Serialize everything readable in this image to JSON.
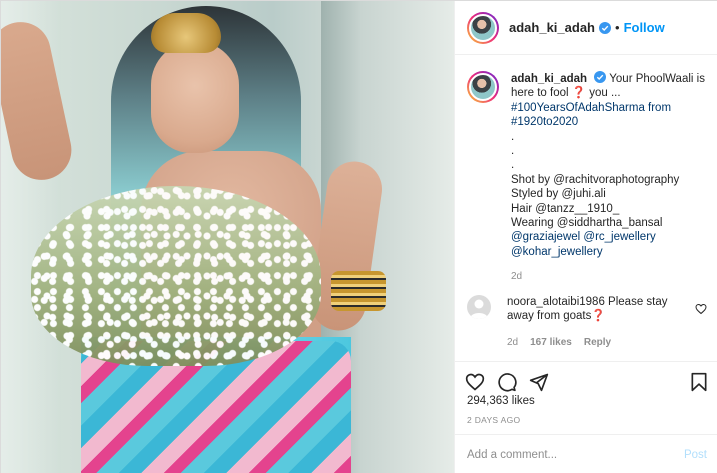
{
  "post": {
    "author": {
      "username": "adah_ki_adah",
      "verified": true
    },
    "header": {
      "dot": "•",
      "follow_label": "Follow"
    },
    "caption": {
      "username": "adah_ki_adah",
      "lines": [
        "Your PhoolWaali is",
        "here to fool ❓ you ...",
        "#100YearsOfAdahSharma from",
        "#1920to2020",
        ".",
        ".",
        ".",
        "Shot by @rachitvoraphotography",
        "Styled by @juhi.ali",
        "Hair @tanzz__1910_",
        "Wearing @siddhartha_bansal",
        "@graziajewel @rc_jewellery",
        "@kohar_jewellery"
      ],
      "time": "2d"
    },
    "comment": {
      "username": "noora_alotaibi1986",
      "text": "Please stay away from goats❓",
      "time": "2d",
      "likes": "167 likes",
      "reply_label": "Reply"
    },
    "likes_text": "294,363 likes",
    "timestamp": "2 DAYS AGO",
    "add_comment_placeholder": "Add a comment...",
    "post_label": "Post"
  },
  "icons": {
    "like": "heart-icon",
    "comment": "comment-icon",
    "share": "share-icon",
    "save": "bookmark-icon",
    "verified": "verified-badge-icon",
    "comment_like": "heart-small-icon"
  },
  "colors": {
    "accent": "#0095f6",
    "link": "#00376b",
    "muted": "#8e8e8e",
    "post_disabled": "#b2dffc"
  }
}
